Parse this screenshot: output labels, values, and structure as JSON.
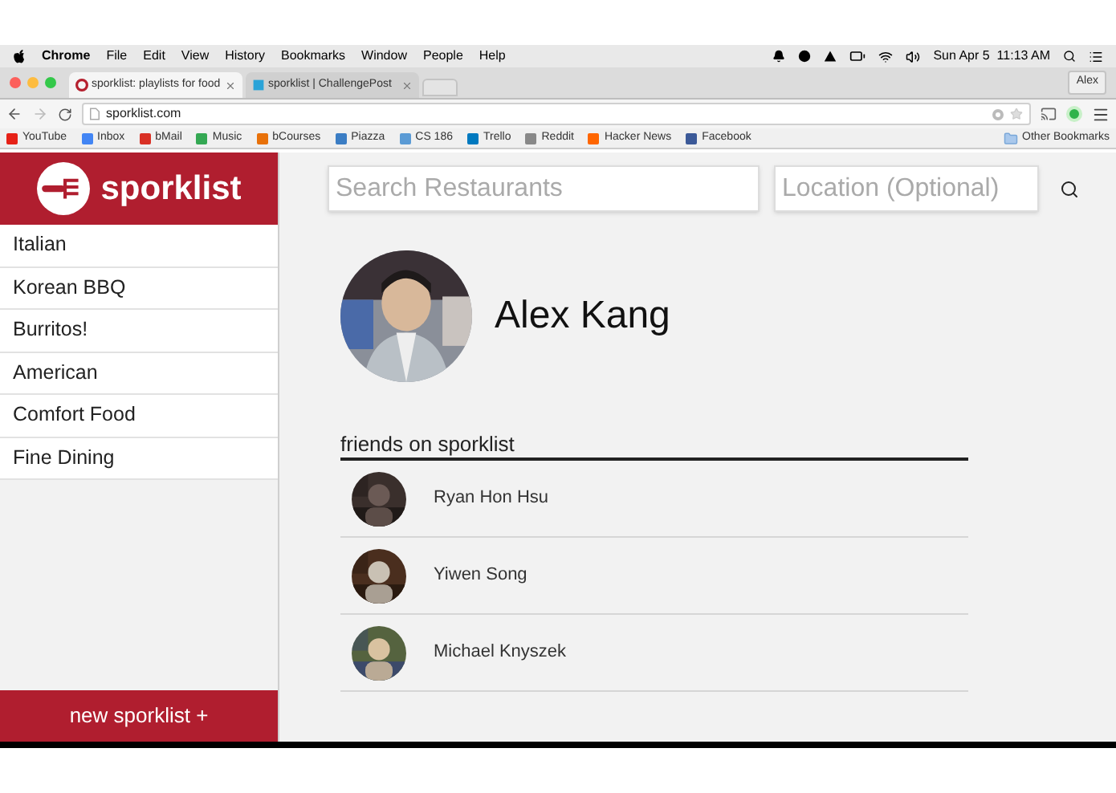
{
  "menubar": {
    "app": "Chrome",
    "menus": [
      "File",
      "Edit",
      "View",
      "History",
      "Bookmarks",
      "Window",
      "People",
      "Help"
    ],
    "clock": "Sun Apr 5  11:13 AM"
  },
  "tabs": [
    {
      "title": "sporklist: playlists for food",
      "selected": true
    },
    {
      "title": "sporklist | ChallengePost",
      "selected": false
    }
  ],
  "profile_button": "Alex",
  "address": "sporklist.com",
  "bookmarks": [
    {
      "label": "YouTube",
      "color": "#e62117"
    },
    {
      "label": "Inbox",
      "color": "#4285f4"
    },
    {
      "label": "bMail",
      "color": "#d93025"
    },
    {
      "label": "Music",
      "color": "#34a853"
    },
    {
      "label": "bCourses",
      "color": "#e8710a"
    },
    {
      "label": "Piazza",
      "color": "#3b7dc4"
    },
    {
      "label": "CS 186",
      "color": "#5b9bd5"
    },
    {
      "label": "Trello",
      "color": "#0079bf"
    },
    {
      "label": "Reddit",
      "color": "#888888"
    },
    {
      "label": "Hacker News",
      "color": "#ff6600"
    },
    {
      "label": "Facebook",
      "color": "#3b5998"
    }
  ],
  "other_bookmarks": "Other Bookmarks",
  "brand": "sporklist",
  "categories": [
    "Italian",
    "Korean BBQ",
    "Burritos!",
    "American",
    "Comfort Food",
    "Fine Dining"
  ],
  "new_button": "new sporklist +",
  "search": {
    "placeholder": "Search Restaurants"
  },
  "location": {
    "placeholder": "Location (Optional)"
  },
  "user": {
    "name": "Alex Kang"
  },
  "friends_heading": "friends on sporklist",
  "friends": [
    {
      "name": "Ryan Hon Hsu"
    },
    {
      "name": "Yiwen Song"
    },
    {
      "name": "Michael Knyszek"
    }
  ]
}
